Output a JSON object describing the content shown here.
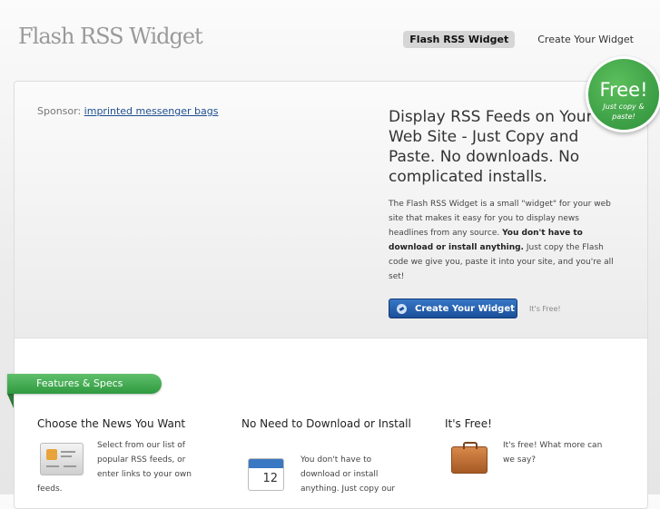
{
  "header": {
    "logo": "Flash RSS Widget",
    "nav": [
      {
        "label": "Flash RSS Widget",
        "active": true
      },
      {
        "label": "Create Your Widget",
        "active": false
      }
    ]
  },
  "hero": {
    "sponsor_prefix": "Sponsor:",
    "sponsor_link": "imprinted messenger bags",
    "title": "Display RSS Feeds on Your Web Site - Just Copy and Paste. No downloads. No complicated installs.",
    "text_1": "The Flash RSS Widget is a small \"widget\" for your web site that makes it easy for you to display news headlines from any source. ",
    "text_bold": "You don't have to download or install anything.",
    "text_2": " Just copy the Flash code we give you, paste it into your site, and you're all set!",
    "cta_label": "Create Your Widget",
    "cta_note": "It's Free!"
  },
  "badge": {
    "big": "Free!",
    "small_1": "Just copy &",
    "small_2": "paste!"
  },
  "features": {
    "tab_label": "Features & Specs",
    "items": [
      {
        "title": "Choose the News You Want",
        "text": "Select from our list of popular RSS feeds, or enter links to your own",
        "tail": "feeds."
      },
      {
        "title": "No Need to Download or Install",
        "text": "You don't have to download or install anything. Just copy our"
      },
      {
        "title": "It's Free!",
        "text": "It's free! What more can we say?"
      }
    ]
  },
  "icons": {
    "calendar_number": "12"
  },
  "colors": {
    "accent_blue": "#1a4e99",
    "badge_green": "#2d8f3a"
  }
}
